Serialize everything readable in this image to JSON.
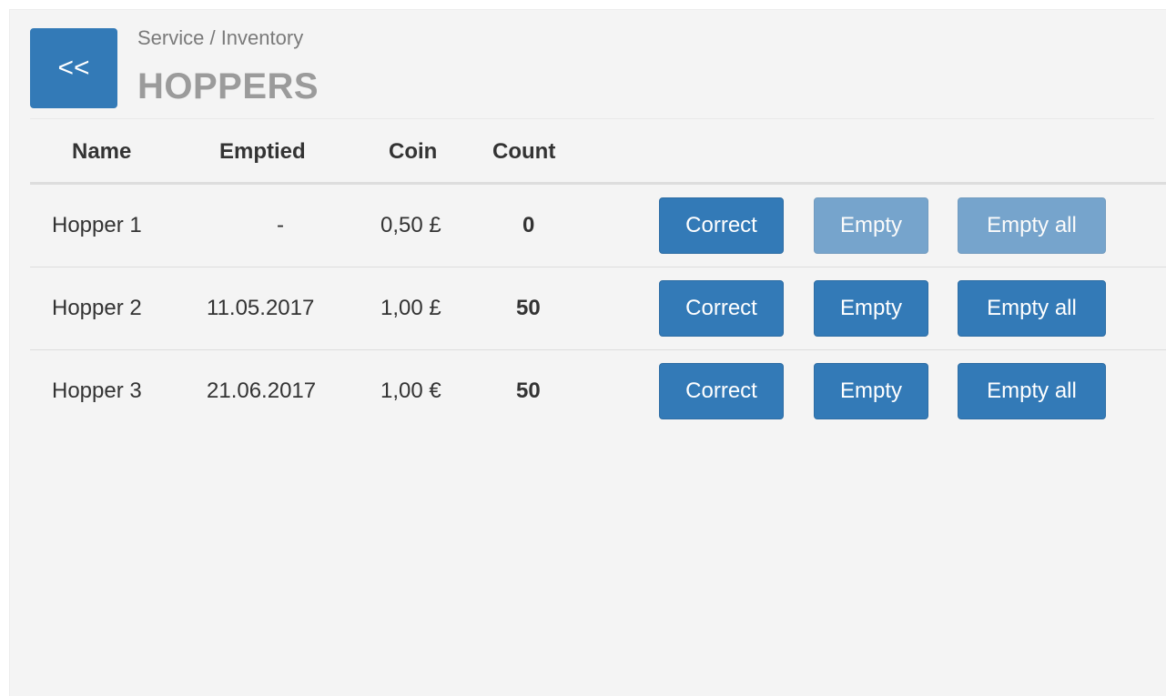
{
  "header": {
    "back_label": "<<",
    "breadcrumb": "Service / Inventory",
    "title": "HOPPERS"
  },
  "table": {
    "columns": [
      "Name",
      "Emptied",
      "Coin",
      "Count"
    ],
    "rows": [
      {
        "name": "Hopper 1",
        "emptied": "-",
        "coin": "0,50 £",
        "count": "0",
        "correct_label": "Correct",
        "empty_label": "Empty",
        "empty_all_label": "Empty all",
        "empty_enabled": false,
        "empty_all_enabled": false
      },
      {
        "name": "Hopper 2",
        "emptied": "11.05.2017",
        "coin": "1,00 £",
        "count": "50",
        "correct_label": "Correct",
        "empty_label": "Empty",
        "empty_all_label": "Empty all",
        "empty_enabled": true,
        "empty_all_enabled": true
      },
      {
        "name": "Hopper 3",
        "emptied": "21.06.2017",
        "coin": "1,00 €",
        "count": "50",
        "correct_label": "Correct",
        "empty_label": "Empty",
        "empty_all_label": "Empty all",
        "empty_enabled": true,
        "empty_all_enabled": true
      }
    ]
  },
  "colors": {
    "primary": "#337ab7",
    "background": "#f4f4f4",
    "title": "#9b9b9b",
    "breadcrumb": "#7a7a7a"
  },
  "icons": {
    "back": "double-chevron-left-icon"
  }
}
